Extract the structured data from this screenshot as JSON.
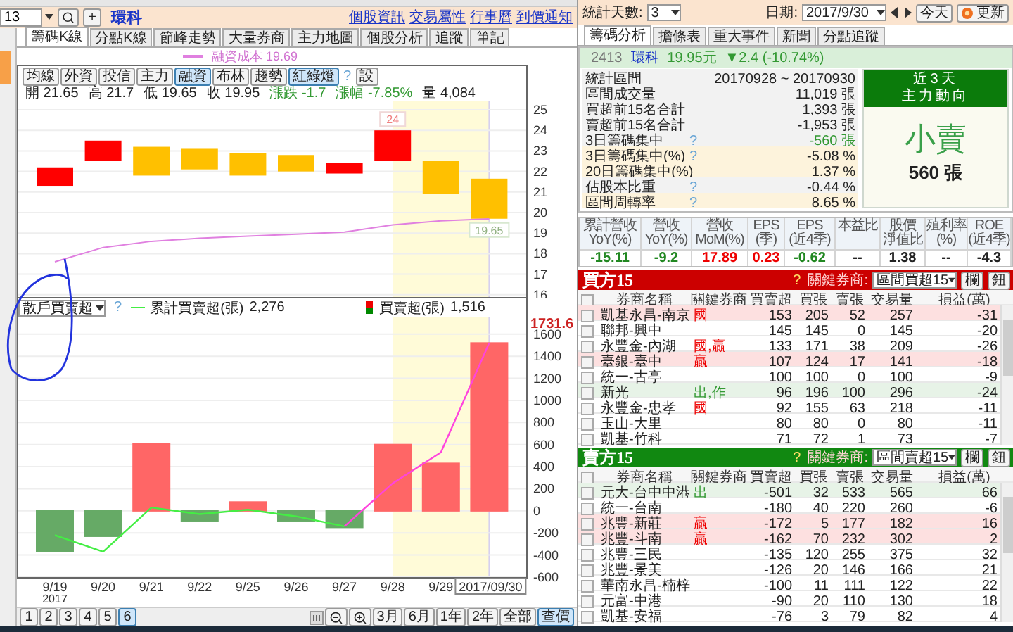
{
  "toolbar": {
    "code": "13",
    "add": "+",
    "title": "環科",
    "links": [
      "個股資訊",
      "交易屬性",
      "行事曆",
      "到價通知"
    ]
  },
  "left_tabs": [
    {
      "label": "籌碼K線",
      "selected": true
    },
    {
      "label": "分點K線",
      "selected": false
    },
    {
      "label": "節峰走勢",
      "selected": false
    },
    {
      "label": "大量券商",
      "selected": false
    },
    {
      "label": "主力地圖",
      "selected": false
    },
    {
      "label": "個股分析",
      "selected": false
    },
    {
      "label": "追蹤",
      "selected": false
    },
    {
      "label": "筆記",
      "selected": false
    }
  ],
  "price_chart": {
    "legend": "融資成本 19.69",
    "toggles": [
      {
        "label": "均線",
        "selected": false
      },
      {
        "label": "外資",
        "selected": false
      },
      {
        "label": "投信",
        "selected": false
      },
      {
        "label": "主力",
        "selected": false
      },
      {
        "label": "融資",
        "selected": true
      },
      {
        "label": "布林",
        "selected": false
      },
      {
        "label": "趨勢",
        "selected": false
      },
      {
        "label": "紅綠燈",
        "selected": true
      }
    ],
    "help": "?",
    "settings": "設",
    "quote": [
      {
        "text": "開 21.65",
        "color": "#222222"
      },
      {
        "text": "高 21.7",
        "color": "#222222"
      },
      {
        "text": "低 19.65",
        "color": "#222222"
      },
      {
        "text": "收 19.95",
        "color": "#222222"
      },
      {
        "text": "漲跌 -1.7",
        "color": "#339933"
      },
      {
        "text": "漲幅 -7.85%",
        "color": "#339933"
      },
      {
        "text": "量 4,084",
        "color": "#222222"
      }
    ],
    "high_label": "24",
    "low_label": "19.65",
    "y_axis_labels": [
      "25",
      "24",
      "23",
      "22",
      "21",
      "20",
      "19",
      "18",
      "17",
      "16"
    ]
  },
  "flow_chart": {
    "selector": "散戶買賣超",
    "help": "?",
    "line_value": "2,276",
    "bar_value": "1,516",
    "last_value_label": "1731.6",
    "year_label": "2017",
    "chart_data": {
      "type": "bar",
      "grid": true,
      "bands": [
        {
          "axis": "x",
          "from": "9/28",
          "to": "2017/09/30",
          "color": "#fffbd8"
        }
      ],
      "ref_lines": [
        {
          "axis": "x",
          "value": "2017/09/30",
          "color": "#d6d0f0"
        }
      ],
      "categories": [
        "9/19",
        "9/20",
        "9/21",
        "9/22",
        "9/25",
        "9/26",
        "9/27",
        "9/28",
        "9/29",
        "2017/09/30"
      ],
      "ylim": [
        -600,
        1758
      ],
      "yticks": [
        -600,
        -400,
        -200,
        0,
        200,
        400,
        600,
        800,
        1000,
        1200,
        1400,
        1600
      ],
      "series": [
        {
          "name": "買賣超(張)",
          "type": "bar",
          "colors": [
            "#66aa66",
            "#66aa66",
            "#ff6666",
            "#66aa66",
            "#ff6666",
            "#66aa66",
            "#66aa66",
            "#ff6666",
            "#ff6666",
            "#ff6666"
          ],
          "values": [
            -370,
            -230,
            610,
            -90,
            80,
            -90,
            -150,
            600,
            430,
            1520
          ]
        },
        {
          "name": "累計買賣超(張)",
          "type": "line",
          "color": "#44ee44",
          "values": [
            -220,
            -370,
            30,
            -30,
            10,
            -50,
            -140,
            null,
            null,
            null
          ]
        },
        {
          "type": "line",
          "color": "#ff44dd",
          "values": [
            null,
            null,
            null,
            null,
            null,
            null,
            -140,
            250,
            530,
            1520
          ]
        }
      ]
    }
  },
  "pager": {
    "pages": [
      {
        "label": "1",
        "selected": false
      },
      {
        "label": "2",
        "selected": false
      },
      {
        "label": "3",
        "selected": false
      },
      {
        "label": "4",
        "selected": false
      },
      {
        "label": "5",
        "selected": false
      },
      {
        "label": "6",
        "selected": true
      }
    ],
    "ranges": [
      {
        "label": "3月",
        "selected": false
      },
      {
        "label": "6月",
        "selected": false
      },
      {
        "label": "1年",
        "selected": false
      },
      {
        "label": "2年",
        "selected": false
      },
      {
        "label": "全部",
        "selected": false
      },
      {
        "label": "查價",
        "selected": true
      }
    ]
  },
  "right": {
    "days_label": "統計天數:",
    "days": "3",
    "date_label": "日期:",
    "date": "2017/9/30",
    "today": "今天",
    "refresh": "更新",
    "tabs": [
      {
        "label": "籌碼分析",
        "selected": true
      },
      {
        "label": "擔條表",
        "selected": false
      },
      {
        "label": "重大事件",
        "selected": false
      },
      {
        "label": "新聞",
        "selected": false
      },
      {
        "label": "分點追蹤",
        "selected": false
      }
    ],
    "summary": {
      "code": "2413",
      "name": "環科",
      "price": "19.95元",
      "change": "▼2.4 (-10.74%)"
    },
    "stats": [
      {
        "label": "統計區間",
        "value": "20170928 ~ 20170930",
        "shaded": false
      },
      {
        "label": "區間成交量",
        "value": "11,019 張",
        "shaded": false
      },
      {
        "label": "買超前15名合計",
        "value": "1,393 張",
        "shaded": false
      },
      {
        "label": "賣超前15名合計",
        "value": "-1,953 張",
        "shaded": false
      },
      {
        "label": "3日籌碼集中",
        "help": "?",
        "value": "-560 張",
        "color": "#339933",
        "shaded": false
      },
      {
        "label": "3日籌碼集中(%)",
        "help": "?",
        "value": "-5.08 %",
        "shaded": true
      },
      {
        "label": "20日籌碼集中(%)",
        "value": "1.37 %",
        "shaded": true
      },
      {
        "label": "佔股本比重",
        "help": "?",
        "value": "-0.44 %",
        "shaded": false
      },
      {
        "label": "區間周轉率",
        "help": "?",
        "value": "8.65 %",
        "shaded": true
      }
    ],
    "trend": {
      "period": "近3天",
      "title": "主力動向",
      "verdict": "小賣",
      "amount": "560 張"
    },
    "metrics": [
      {
        "header": [
          "累計營收",
          "YoY(%)"
        ],
        "value": "-15.11",
        "color": "#228822"
      },
      {
        "header": [
          "營收",
          "YoY(%)"
        ],
        "value": "-9.2",
        "color": "#228822"
      },
      {
        "header": [
          "營收",
          "MoM(%)"
        ],
        "value": "17.89",
        "color": "#ee0000"
      },
      {
        "header": [
          "EPS",
          "(季)"
        ],
        "value": "0.23",
        "color": "#ee0000"
      },
      {
        "header": [
          "EPS",
          "(近4季)"
        ],
        "value": "-0.62",
        "color": "#228822"
      },
      {
        "header": [
          "本益比"
        ],
        "value": "--",
        "color": "#222222"
      },
      {
        "header": [
          "股價",
          "淨值比"
        ],
        "value": "1.38",
        "color": "#222222"
      },
      {
        "header": [
          "殖利率",
          "(%)"
        ],
        "value": "--",
        "color": "#222222"
      },
      {
        "header": [
          "ROE",
          "(近4季)"
        ],
        "value": "-4.3",
        "color": "#222222"
      }
    ],
    "buy": {
      "kind": "buy",
      "title": "買方15",
      "help": "?",
      "key_label": "關鍵券商:",
      "select": "區間買超15",
      "buttons": [
        "欄",
        "鈕"
      ],
      "all_checked": false,
      "columns": [
        "券商名稱",
        "關鍵券商",
        "買賣超",
        "買張",
        "賣張",
        "交易量",
        "損益(萬)"
      ],
      "rows": [
        {
          "checked": false,
          "highlighted": true,
          "cells": [
            "凱基永昌-南京",
            "國",
            "153",
            "205",
            "52",
            "257",
            "-31"
          ],
          "color": "#ee0000"
        },
        {
          "checked": false,
          "highlighted": false,
          "cells": [
            "聯邦-興中",
            "",
            "145",
            "145",
            "0",
            "145",
            "-20"
          ]
        },
        {
          "checked": false,
          "highlighted": false,
          "cells": [
            "永豐金-內湖",
            "國,贏",
            "133",
            "171",
            "38",
            "209",
            "-26"
          ],
          "color": "#ee0000"
        },
        {
          "checked": false,
          "highlighted": true,
          "cells": [
            "臺銀-臺中",
            "贏",
            "107",
            "124",
            "17",
            "141",
            "-18"
          ],
          "color": "#ee0000"
        },
        {
          "checked": false,
          "highlighted": false,
          "cells": [
            "統一-古亭",
            "",
            "100",
            "100",
            "0",
            "100",
            "-9"
          ]
        },
        {
          "checked": false,
          "highlighted": true,
          "cells": [
            "新光",
            "出,作",
            "96",
            "196",
            "100",
            "296",
            "-24"
          ],
          "color": "#339933"
        },
        {
          "checked": false,
          "highlighted": false,
          "cells": [
            "永豐金-忠孝",
            "國",
            "92",
            "155",
            "63",
            "218",
            "-11"
          ],
          "color": "#ee0000"
        },
        {
          "checked": false,
          "highlighted": false,
          "cells": [
            "玉山-大里",
            "",
            "80",
            "80",
            "0",
            "80",
            "-11"
          ]
        },
        {
          "checked": false,
          "highlighted": false,
          "cells": [
            "凱基-竹科",
            "",
            "71",
            "72",
            "1",
            "73",
            "-7"
          ]
        }
      ]
    },
    "sell": {
      "kind": "sell",
      "title": "賣方15",
      "help": "?",
      "key_label": "關鍵券商:",
      "select": "區間賣超15",
      "buttons": [
        "欄",
        "鈕"
      ],
      "all_checked": false,
      "columns": [
        "券商名稱",
        "關鍵券商",
        "買賣超",
        "買張",
        "賣張",
        "交易量",
        "損益(萬)"
      ],
      "rows": [
        {
          "checked": false,
          "highlighted": true,
          "cells": [
            "元大-台中中港",
            "出",
            "-501",
            "32",
            "533",
            "565",
            "66"
          ],
          "color": "#339933"
        },
        {
          "checked": false,
          "highlighted": false,
          "cells": [
            "統一-台南",
            "",
            "-180",
            "40",
            "220",
            "260",
            "-6"
          ]
        },
        {
          "checked": false,
          "highlighted": true,
          "cells": [
            "兆豐-新莊",
            "贏",
            "-172",
            "5",
            "177",
            "182",
            "16"
          ],
          "color": "#ee0000"
        },
        {
          "checked": false,
          "highlighted": true,
          "cells": [
            "兆豐-斗南",
            "贏",
            "-162",
            "70",
            "232",
            "302",
            "2"
          ],
          "color": "#ee0000"
        },
        {
          "checked": false,
          "highlighted": false,
          "cells": [
            "兆豐-三民",
            "",
            "-135",
            "120",
            "255",
            "375",
            "32"
          ]
        },
        {
          "checked": false,
          "highlighted": false,
          "cells": [
            "兆豐-景美",
            "",
            "-126",
            "20",
            "146",
            "166",
            "21"
          ]
        },
        {
          "checked": false,
          "highlighted": false,
          "cells": [
            "華南永昌-楠梓",
            "",
            "-100",
            "11",
            "111",
            "122",
            "22"
          ]
        },
        {
          "checked": false,
          "highlighted": false,
          "cells": [
            "元富-中港",
            "",
            "-90",
            "20",
            "110",
            "130",
            "18"
          ]
        },
        {
          "checked": false,
          "highlighted": false,
          "cells": [
            "凱基-安福",
            "",
            "-76",
            "3",
            "79",
            "82",
            "4"
          ]
        }
      ]
    }
  }
}
